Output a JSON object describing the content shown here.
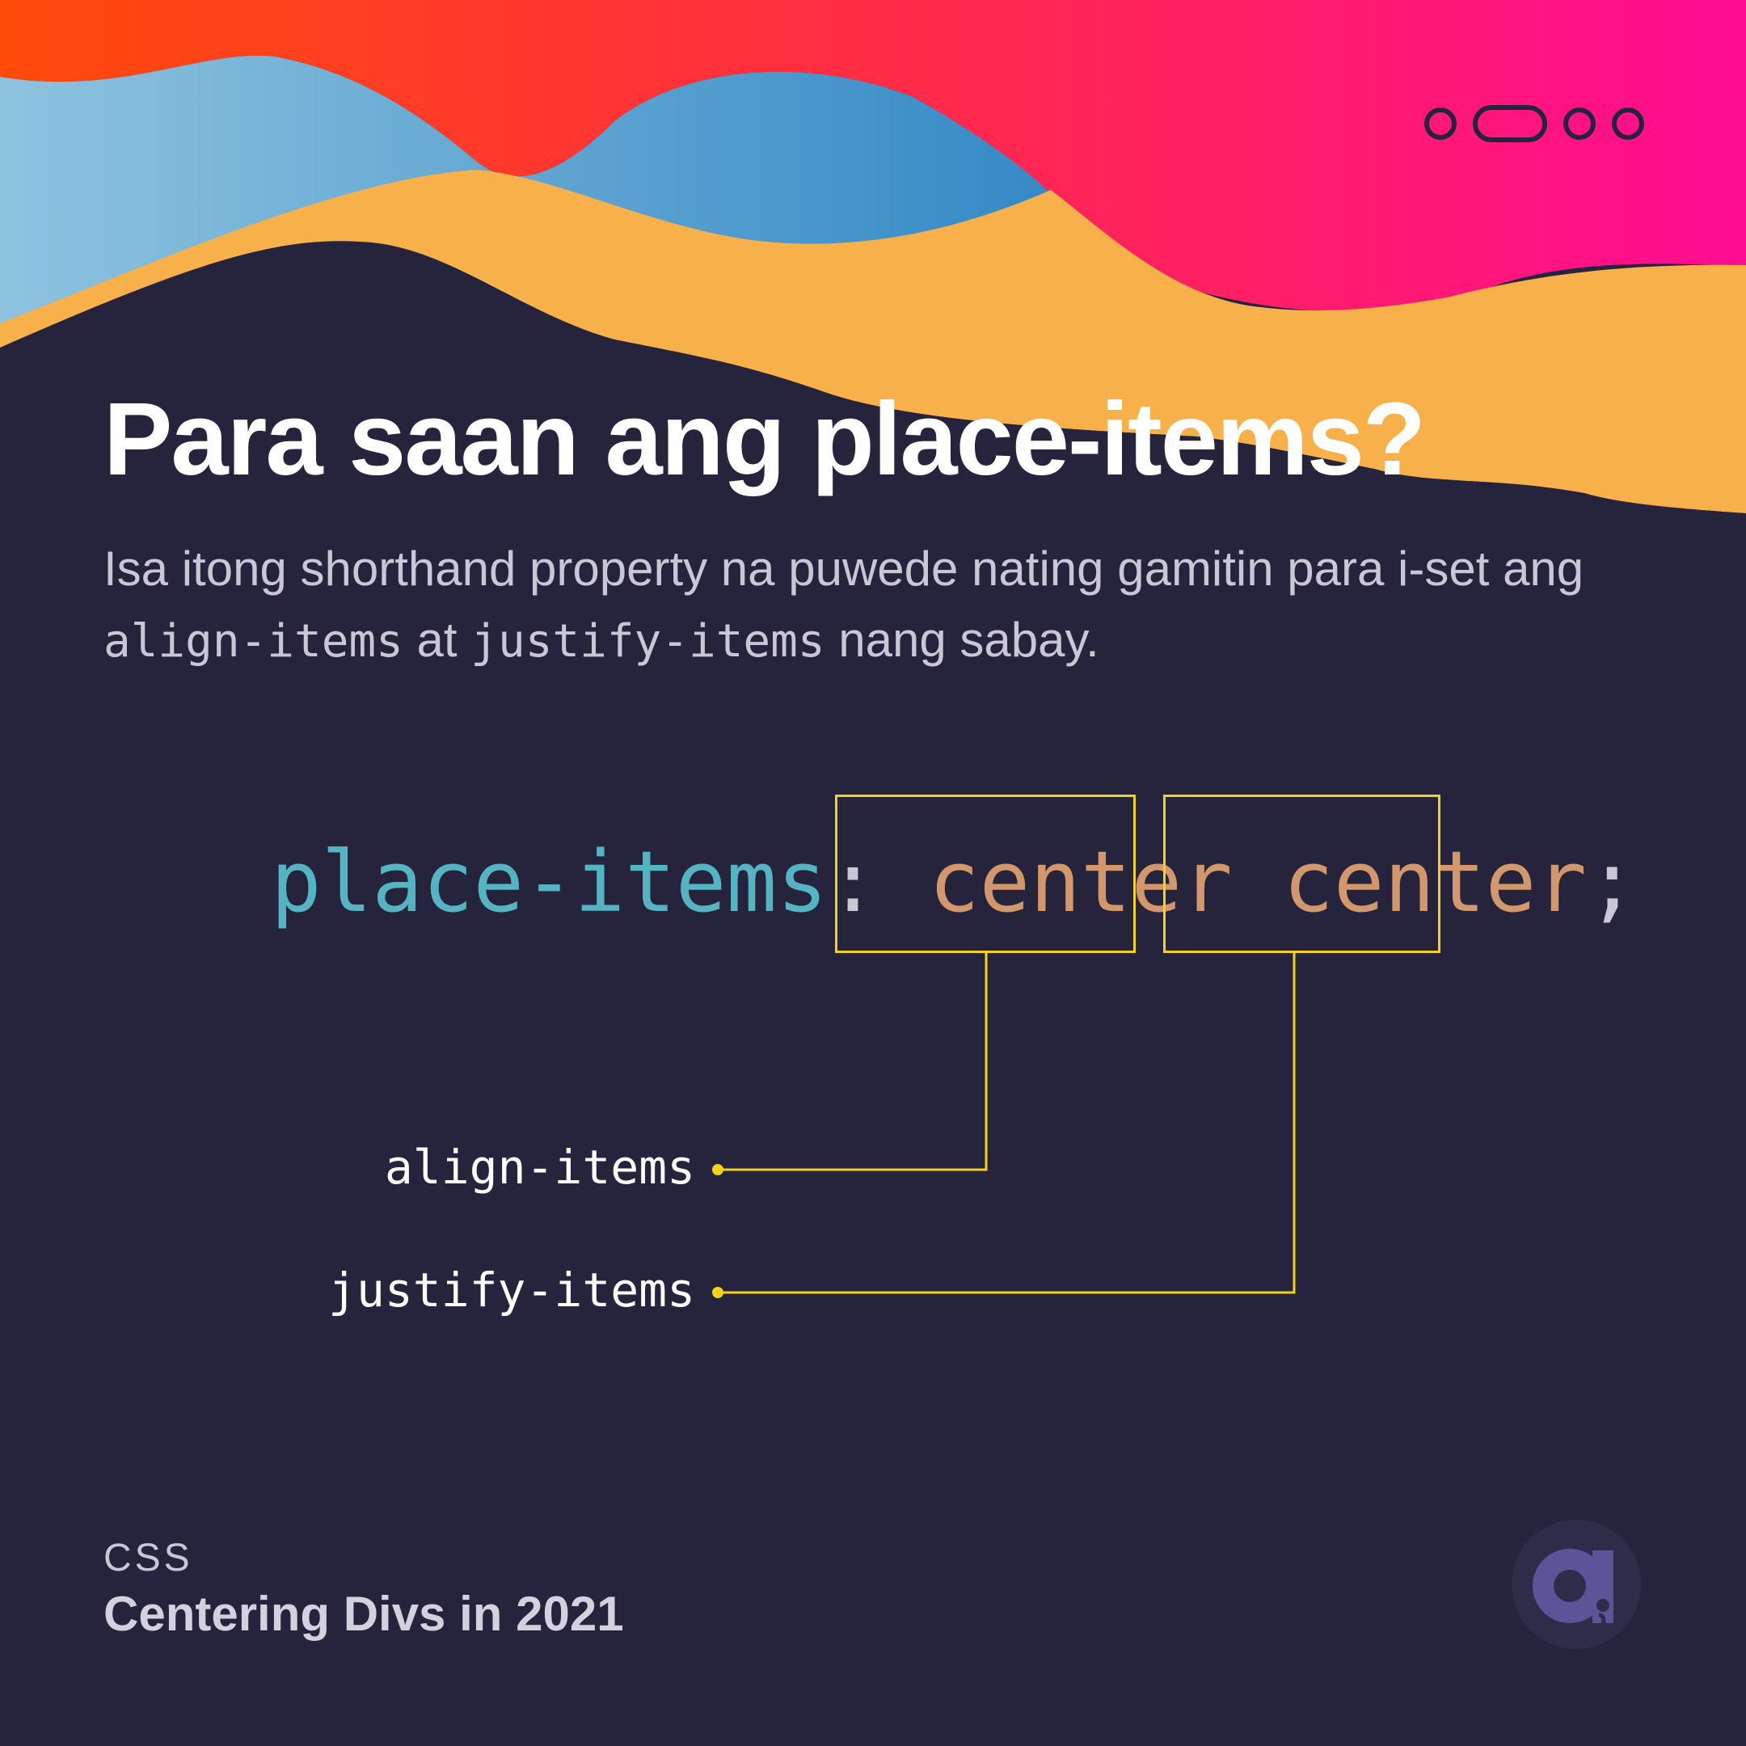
{
  "header": {
    "title": "Para saan ang place-items?",
    "subtitle": {
      "before": "Isa itong shorthand property na puwede nating gamitin para i-set ang ",
      "code1": "align-items",
      "middle": " at ",
      "code2": "justify-items",
      "after": " nang sabay."
    }
  },
  "code_example": {
    "property": "place-items",
    "colon": ":",
    "value1": "center",
    "value2": "center",
    "semicolon": ";"
  },
  "labels": {
    "first": "align-items",
    "second": "justify-items"
  },
  "footer": {
    "category": "CSS",
    "series_title": "Centering Divs in 2021"
  },
  "colors": {
    "background": "#26243d",
    "highlight": "#f3d21d",
    "property": "#55b4c2",
    "value": "#d2976a"
  },
  "icons": {
    "carousel_indicator": "carousel-dots-icon",
    "brand": "brand-logo-icon"
  }
}
